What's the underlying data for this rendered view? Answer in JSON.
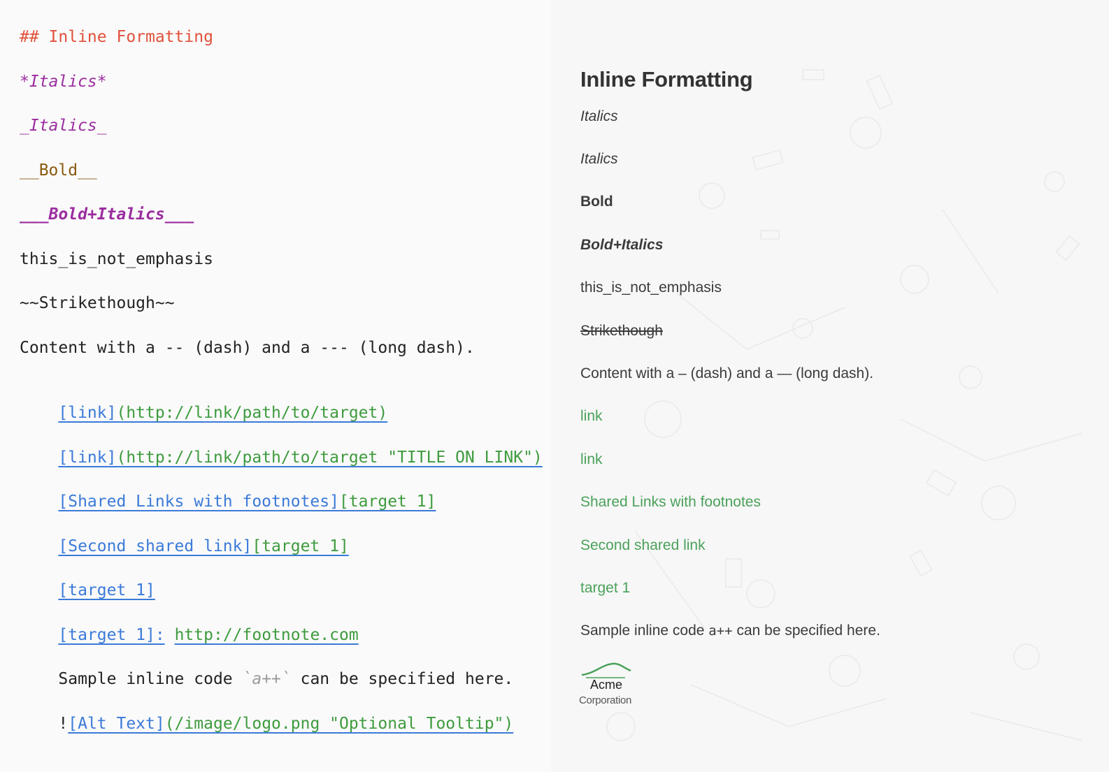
{
  "editor": {
    "heading": "## Inline Formatting",
    "italics_star": "*Italics*",
    "italics_underscore": "_Italics_",
    "bold": "__Bold__",
    "bold_italics": "___Bold+Italics___",
    "not_emphasis": "this_is_not_emphasis",
    "strikethrough": "~~Strikethough~~",
    "dash_line": "Content with a -- (dash) and a --- (long dash).",
    "link1_text": "[link]",
    "link1_url": "(http://link/path/to/target)",
    "link2_text": "[link]",
    "link2_url": "(http://link/path/to/target \"TITLE ON LINK\")",
    "shared_text": "[Shared Links with footnotes]",
    "shared_ref": "[target 1]",
    "second_text": "[Second shared link]",
    "second_ref": "[target 1]",
    "target_only": "[target 1]",
    "footnote_label": "[target 1]:",
    "footnote_url": "http://footnote.com",
    "code_before": "Sample inline code ",
    "code_value": "`a++`",
    "code_after": " can be specified here.",
    "image_bang": "!",
    "image_alt": "[Alt Text]",
    "image_src": "(/image/logo.png \"Optional Tooltip\")"
  },
  "preview": {
    "heading": "Inline Formatting",
    "italics1": "Italics",
    "italics2": "Italics",
    "bold": "Bold",
    "bold_italics": "Bold+Italics",
    "not_emphasis": "this_is_not_emphasis",
    "strikethrough": "Strikethough",
    "dash_line": "Content with a – (dash) and a — (long dash).",
    "link1": "link",
    "link2": "link",
    "shared": "Shared Links with footnotes",
    "second": "Second shared link",
    "target": "target 1",
    "code_before": "Sample inline code ",
    "code_value": "a++",
    "code_after": " can be specified here.",
    "logo_name": "Acme",
    "logo_sub": "Corporation"
  },
  "colors": {
    "heading": "#e0513c",
    "emphasis": "#9b2d9f",
    "bold": "#8b5a10",
    "link_text": "#3b7ad9",
    "link_url": "#3e9b3e",
    "preview_link": "#4aa15a"
  }
}
